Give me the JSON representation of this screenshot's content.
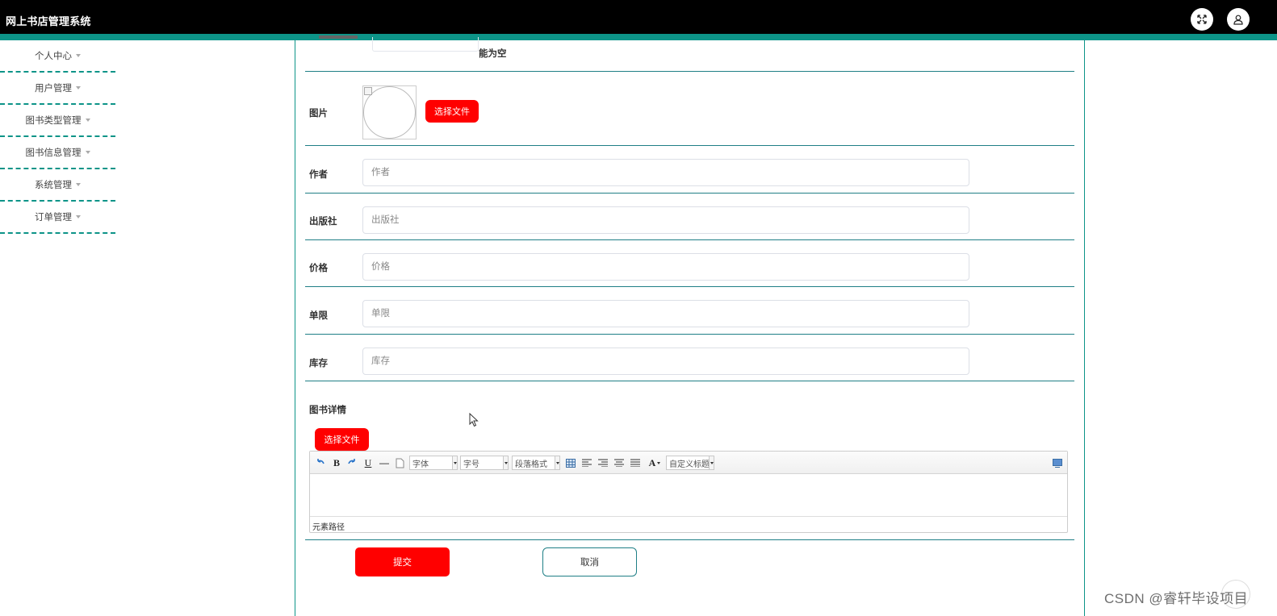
{
  "app": {
    "title": "网上书店管理系统"
  },
  "header": {
    "fullscreen_icon": "expand-arrows-icon",
    "user_icon": "user-icon"
  },
  "sidebar": {
    "items": [
      {
        "label": "个人中心"
      },
      {
        "label": "用户管理"
      },
      {
        "label": "图书类型管理"
      },
      {
        "label": "图书信息管理"
      },
      {
        "label": "系统管理"
      },
      {
        "label": "订单管理"
      }
    ]
  },
  "form": {
    "partial_hint": "能为空",
    "image": {
      "label": "图片",
      "upload_label": "选择文件"
    },
    "author": {
      "label": "作者",
      "placeholder": "作者",
      "value": ""
    },
    "publisher": {
      "label": "出版社",
      "placeholder": "出版社",
      "value": ""
    },
    "price": {
      "label": "价格",
      "placeholder": "价格",
      "value": ""
    },
    "limit": {
      "label": "单限",
      "placeholder": "单限",
      "value": ""
    },
    "stock": {
      "label": "库存",
      "placeholder": "库存",
      "value": ""
    },
    "details": {
      "label": "图书详情",
      "upload_label": "选择文件",
      "toolbar": {
        "bold": "B",
        "underline": "U",
        "hr": "—",
        "font_family": "字体",
        "font_size": "字号",
        "paragraph": "段落格式",
        "font_color": "A",
        "custom_title": "自定义标题"
      },
      "status_path": "元素路径"
    },
    "submit_label": "提交",
    "cancel_label": "取消"
  },
  "colors": {
    "accent": "#0d9488",
    "primary_button": "#ff0000",
    "topbar": "#000000"
  },
  "watermark": "CSDN @睿轩毕设项目"
}
